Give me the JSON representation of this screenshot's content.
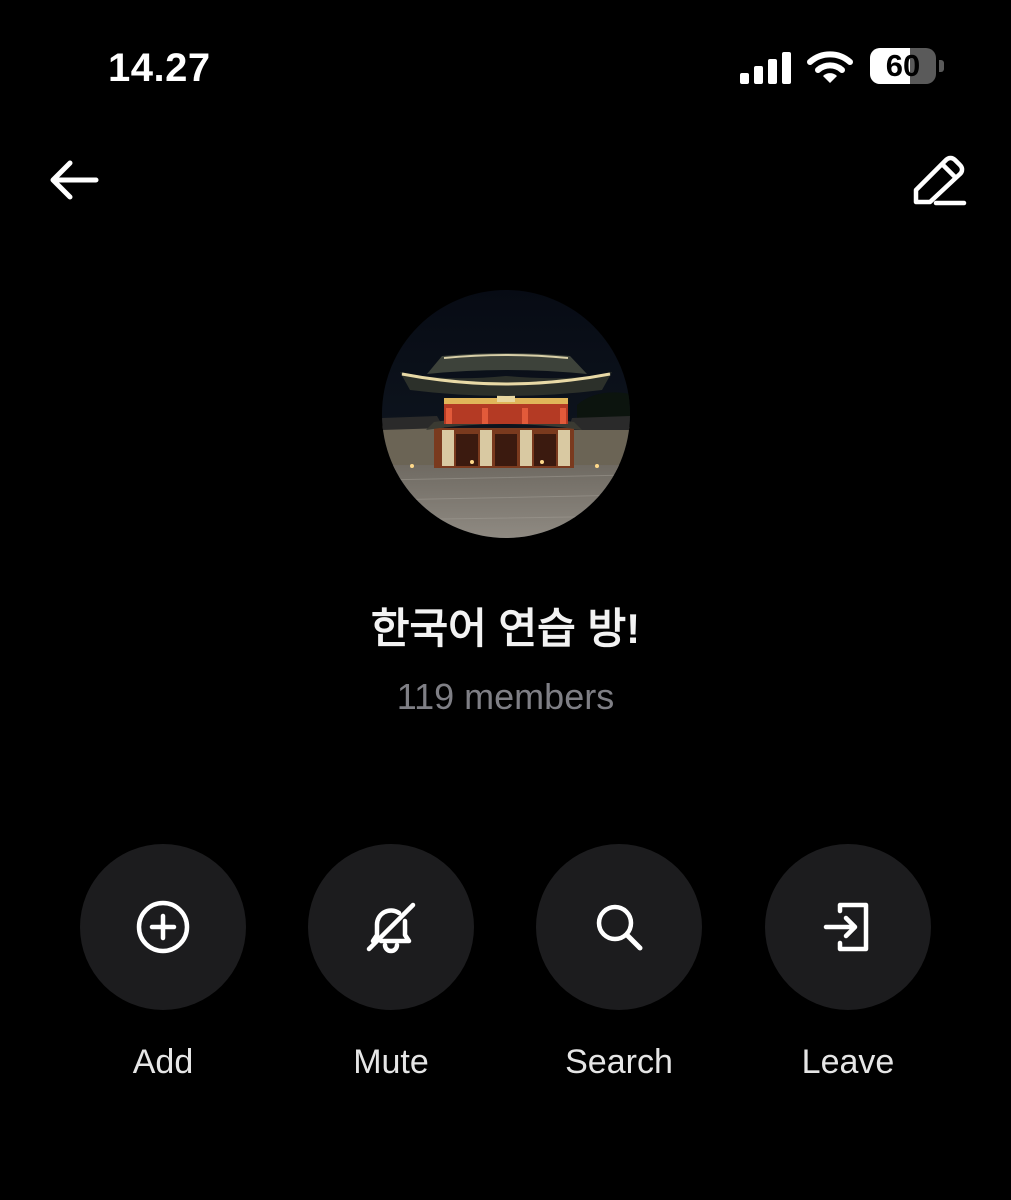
{
  "status_bar": {
    "time": "14.27",
    "battery_level": "60",
    "battery_fraction": 0.6,
    "icons": [
      "cellular-signal-icon",
      "wifi-icon",
      "battery-icon"
    ]
  },
  "header": {
    "back_icon": "arrow-left-icon",
    "edit_icon": "pencil-edit-icon"
  },
  "group": {
    "avatar": "group-avatar-photo",
    "name": "한국어 연습 방!",
    "members": "119 members"
  },
  "actions": [
    {
      "label": "Add",
      "icon": "plus-circle-icon"
    },
    {
      "label": "Mute",
      "icon": "bell-slash-icon"
    },
    {
      "label": "Search",
      "icon": "search-icon"
    },
    {
      "label": "Leave",
      "icon": "exit-door-icon"
    }
  ],
  "colors": {
    "background": "#000000",
    "button_background": "#1c1c1e",
    "secondary_text": "#7f7f85",
    "primary_text": "#f2f2f2"
  }
}
